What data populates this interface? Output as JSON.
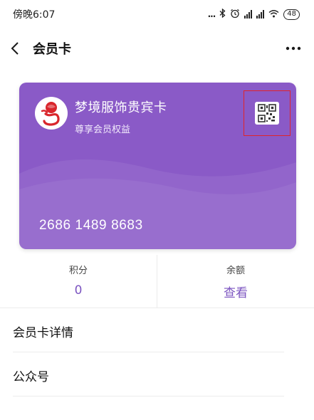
{
  "status_bar": {
    "time": "傍晚6:07",
    "dots": "...",
    "battery": "48"
  },
  "nav": {
    "title": "会员卡"
  },
  "card": {
    "name": "梦境服饰贵宾卡",
    "subtitle": "尊享会员权益",
    "number": "2686 1489 8683",
    "color": "#8a5ac7"
  },
  "stats": {
    "points_label": "积分",
    "points_value": "0",
    "balance_label": "余额",
    "balance_action": "查看"
  },
  "menu": {
    "card_details": "会员卡详情",
    "official_account": "公众号"
  },
  "colors": {
    "accent": "#7c55c1",
    "highlight_box": "#e0242b"
  },
  "icons": [
    "back-icon",
    "more-icon",
    "bluetooth-icon",
    "alarm-icon",
    "signal-icon",
    "wifi-icon",
    "battery-icon",
    "rose-logo-icon",
    "qr-code-icon"
  ]
}
